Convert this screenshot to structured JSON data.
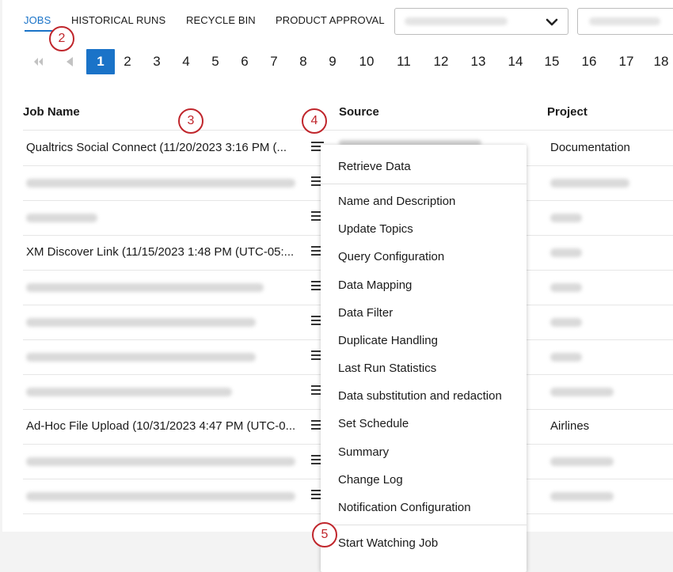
{
  "tabs": [
    {
      "label": "JOBS",
      "active": true
    },
    {
      "label": "HISTORICAL RUNS",
      "active": false
    },
    {
      "label": "RECYCLE BIN",
      "active": false
    },
    {
      "label": "PRODUCT APPROVAL",
      "active": false
    }
  ],
  "pagination": {
    "current": "1",
    "pages": [
      "1",
      "2",
      "3",
      "4",
      "5",
      "6",
      "7",
      "8",
      "9",
      "10",
      "11",
      "12",
      "13",
      "14",
      "15",
      "16",
      "17",
      "18"
    ]
  },
  "table": {
    "headers": {
      "job_name": "Job Name",
      "source": "Source",
      "project": "Project"
    },
    "rows": [
      {
        "name": "Qualtrics Social Connect (11/20/2023 3:16 PM (...",
        "project": "Documentation"
      },
      {
        "name": "",
        "project": ""
      },
      {
        "name": "",
        "project": ""
      },
      {
        "name": "XM Discover Link (11/15/2023 1:48 PM (UTC-05:...",
        "project": ""
      },
      {
        "name": "",
        "project": ""
      },
      {
        "name": "",
        "project": ""
      },
      {
        "name": "",
        "project": ""
      },
      {
        "name": "",
        "project": ""
      },
      {
        "name": "Ad-Hoc File Upload (10/31/2023 4:47 PM (UTC-0...",
        "project": "Airlines"
      },
      {
        "name": "",
        "project": ""
      },
      {
        "name": "",
        "project": ""
      }
    ]
  },
  "badges": {
    "b2": "2",
    "b3": "3",
    "b4": "4",
    "b5": "5"
  },
  "menu": {
    "items": [
      "Retrieve Data",
      "Name and Description",
      "Update Topics",
      "Query Configuration",
      "Data Mapping",
      "Data Filter",
      "Duplicate Handling",
      "Last Run Statistics",
      "Data substitution and redaction",
      "Set Schedule",
      "Summary",
      "Change Log",
      "Notification Configuration",
      "Start Watching Job"
    ]
  },
  "colors": {
    "accent": "#1a73c8",
    "badge": "#c0262c"
  }
}
